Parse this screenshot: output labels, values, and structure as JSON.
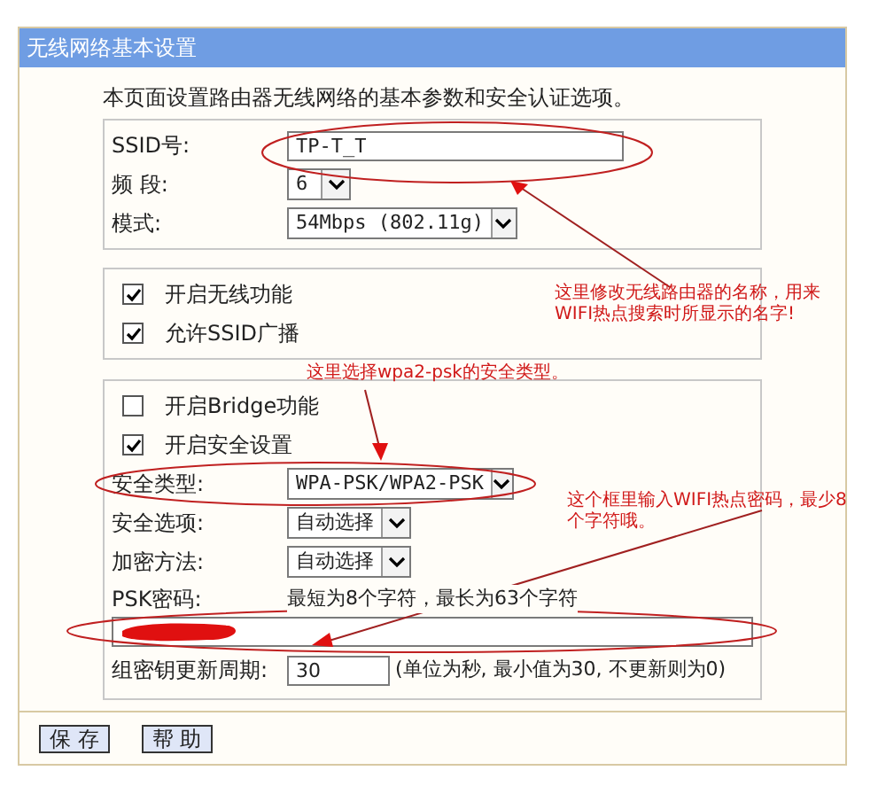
{
  "window": {
    "title": "无线网络基本设置"
  },
  "intro": "本页面设置路由器无线网络的基本参数和安全认证选项。",
  "basic_fields": [
    {
      "label": "SSID号:",
      "kind": "text",
      "value": "TP-T_T"
    },
    {
      "label": "频 段:",
      "kind": "select",
      "value": "6"
    },
    {
      "label": "模式:",
      "kind": "select",
      "value": "54Mbps (802.11g)"
    }
  ],
  "wireless_options": [
    {
      "label": "开启无线功能",
      "checked": true
    },
    {
      "label": "允许SSID广播",
      "checked": true
    }
  ],
  "security_options": [
    {
      "label": "开启Bridge功能",
      "checked": false
    },
    {
      "label": "开启安全设置",
      "checked": true
    }
  ],
  "security_fields": [
    {
      "label": "安全类型:",
      "value": "WPA-PSK/WPA2-PSK"
    },
    {
      "label": "安全选项:",
      "value": "自动选择"
    },
    {
      "label": "加密方法:",
      "value": "自动选择"
    }
  ],
  "psk": {
    "label": "PSK密码:",
    "hint": "最短为8个字符，最长为63个字符"
  },
  "group_key": {
    "label": "组密钥更新周期:",
    "value": "30",
    "hint": "(单位为秒, 最小值为30, 不更新则为0)"
  },
  "buttons": [
    "保 存",
    "帮 助"
  ],
  "annotations": [
    {
      "lines": [
        "这里修改无线路由器的名称，用来",
        "WIFI热点搜索时所显示的名字!"
      ]
    },
    {
      "lines": [
        "这里选择wpa2-psk的安全类型。"
      ]
    },
    {
      "lines": [
        "这个框里输入WIFI热点密码，最少8",
        "个字符哦。"
      ]
    }
  ]
}
